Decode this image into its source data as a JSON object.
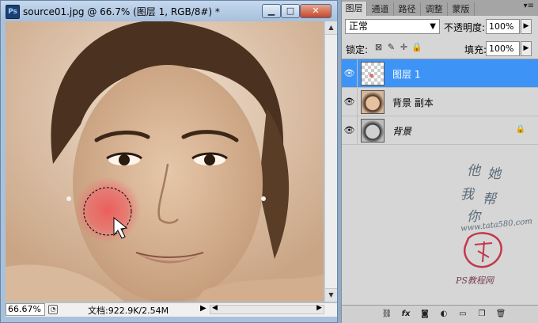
{
  "document": {
    "app_icon": "photoshop-icon",
    "app_icon_text": "Ps",
    "title": "source01.jpg @ 66.7% (图层 1, RGB/8#) *",
    "window_buttons": {
      "minimize": "▁",
      "maximize": "□",
      "close": "✕"
    },
    "status": {
      "zoom": "66.67%",
      "doc_info": "文档:922.9K/2.54M"
    }
  },
  "layers_panel": {
    "tabs": [
      {
        "label": "图层",
        "active": true
      },
      {
        "label": "通道",
        "active": false
      },
      {
        "label": "路径",
        "active": false
      },
      {
        "label": "调整",
        "active": false
      },
      {
        "label": "蒙版",
        "active": false
      }
    ],
    "blend_mode": "正常",
    "opacity_label": "不透明度:",
    "opacity": "100%",
    "lock_label": "锁定:",
    "fill_label": "填充:",
    "fill": "100%",
    "layers": [
      {
        "name": "图层 1",
        "selected": true,
        "thumb": "transparent",
        "locked": false
      },
      {
        "name": "背景 副本",
        "selected": false,
        "thumb": "portrait",
        "locked": false
      },
      {
        "name": "背景",
        "selected": false,
        "thumb": "portrait-gray",
        "locked": true
      }
    ]
  },
  "watermark": {
    "characters": [
      "他",
      "她",
      "我",
      "帮",
      "你"
    ],
    "url": "www.tata580.com",
    "brand": "PS教程网"
  },
  "colors": {
    "selected_layer": "#3d94f6",
    "brush_red": "#e46a6a",
    "canvas_tint": "#d6b89c"
  }
}
